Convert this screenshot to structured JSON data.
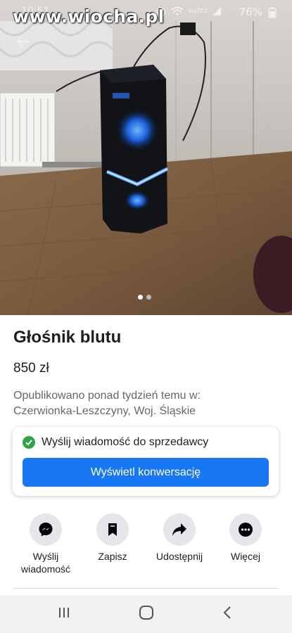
{
  "status_bar": {
    "time": "10:51",
    "battery": "76%",
    "network": "VoLTE2",
    "icons": [
      "alarm-icon",
      "wifi-icon",
      "signal-icon"
    ]
  },
  "watermark": "www.wiocha.pl",
  "photo": {
    "dots_count": 2,
    "active_index": 0
  },
  "listing": {
    "title": "Głośnik blutu",
    "price": "850 zł",
    "published_line1": "Opublikowano ponad tydzień temu w:",
    "published_line2": "Czerwionka-Leszczyny, Woj. Śląskie"
  },
  "message_card": {
    "sent_text": "Wyślij wiadomość do sprzedawcy",
    "button_label": "Wyświetl konwersację"
  },
  "actions": [
    {
      "label_line1": "Wyślij",
      "label_line2": "wiadomość",
      "icon": "messenger-icon"
    },
    {
      "label_line1": "Zapisz",
      "label_line2": "",
      "icon": "bookmark-icon"
    },
    {
      "label_line1": "Udostępnij",
      "label_line2": "",
      "icon": "share-icon"
    },
    {
      "label_line1": "Więcej",
      "label_line2": "",
      "icon": "more-icon"
    }
  ],
  "colors": {
    "accent": "#1877f2",
    "success": "#31a24c",
    "text_primary": "#1c1e21",
    "text_secondary": "#65676b"
  }
}
